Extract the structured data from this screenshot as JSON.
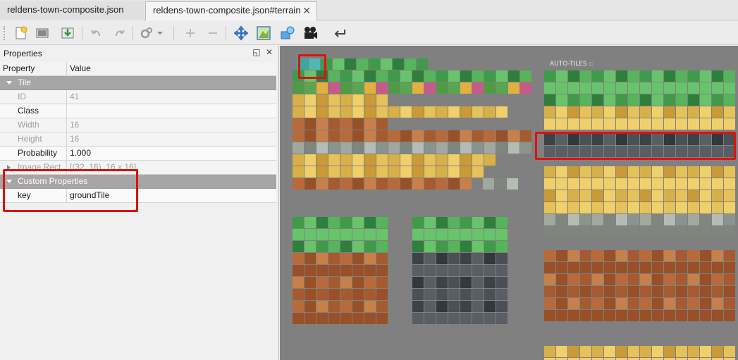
{
  "tabs": [
    {
      "label": "reldens-town-composite.json"
    },
    {
      "label": "reldens-town-composite.json#terrain"
    }
  ],
  "toolbar": {
    "icons": [
      "new-map-icon",
      "open-icon",
      "save-icon",
      "undo-icon",
      "redo-icon",
      "settings-dropdown-icon",
      "add-icon",
      "remove-icon",
      "move-icon",
      "terrain-icon",
      "shapes-icon",
      "animation-icon",
      "back-icon"
    ]
  },
  "properties": {
    "title": "Properties",
    "header": {
      "property": "Property",
      "value": "Value"
    },
    "tile_group": "Tile",
    "rows": [
      {
        "key": "ID",
        "value": "41"
      },
      {
        "key": "Class",
        "value": ""
      },
      {
        "key": "Width",
        "value": "16"
      },
      {
        "key": "Height",
        "value": "16"
      },
      {
        "key": "Probability",
        "value": "1.000"
      },
      {
        "key": "Image Rect",
        "value": "[(32, 16), 16 x 16]"
      }
    ],
    "custom_group": "Custom Properties",
    "custom_rows": [
      {
        "key": "key",
        "value": "groundTile"
      }
    ]
  },
  "canvas": {
    "autotiles_label": "AUTO-TILES ::"
  },
  "colors": {
    "highlight": "#e01010",
    "group_header": "#a6a6a6",
    "canvas_bg": "#808080"
  }
}
